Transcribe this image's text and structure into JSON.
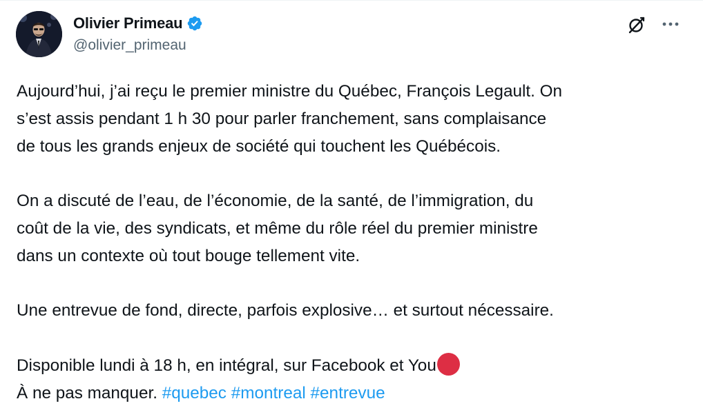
{
  "author": {
    "display_name": "Olivier Primeau",
    "handle": "@olivier_primeau",
    "verified": true
  },
  "header_actions": {
    "grok_icon": "grok-icon",
    "more_icon": "more-icon"
  },
  "tweet": {
    "p1": {
      "l1": "Aujourd’hui, j’ai reçu le premier ministre du Québec, François Legault. On",
      "l2": "s’est assis pendant 1 h 30 pour parler franchement, sans complaisance",
      "l3": "de tous les grands enjeux de société qui touchent les Québécois."
    },
    "p2": {
      "l1": "On a discuté de l’eau, de l’économie, de la santé, de l’immigration, du",
      "l2": "coût de la vie, des syndicats, et même du rôle réel du premier ministre",
      "l3": "dans un contexte où tout bouge tellement vite."
    },
    "p3": {
      "l1": "Une entrevue de fond, directe, parfois explosive… et surtout nécessaire."
    },
    "p4": {
      "l1": "Disponible lundi à 18 h, en intégral, sur Facebook et You",
      "emoji": "red-circle-emoji",
      "l2": "À ne pas manquer. ",
      "hashtags": [
        "#quebec",
        "#montreal",
        "#entrevue"
      ]
    }
  },
  "colors": {
    "text": "#0f1419",
    "secondary": "#536471",
    "link": "#1d9bf0",
    "verified": "#1d9bf0",
    "emoji_red": "#dd2e44"
  }
}
